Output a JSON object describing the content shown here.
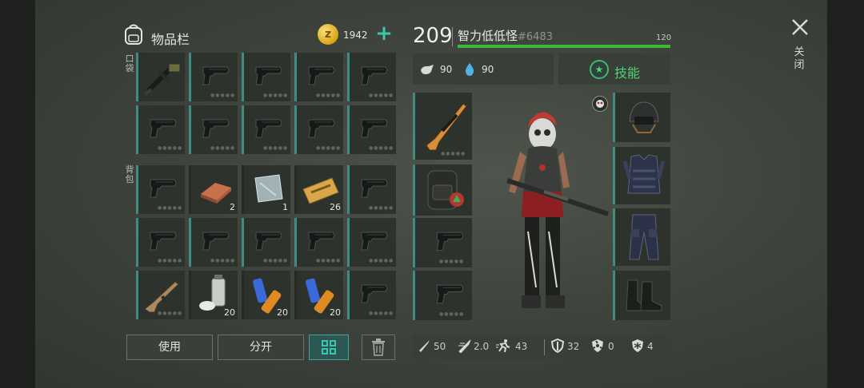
{
  "inventory": {
    "title": "物品栏",
    "pockets_label": "口袋",
    "backpack_label": "背包",
    "coins": "1942",
    "add_coin_symbol": "+"
  },
  "quantities": {
    "copper": "2",
    "steel": "1",
    "coupon": "26",
    "spray": "20",
    "battery1": "20",
    "battery2": "20"
  },
  "buttons": {
    "use": "使用",
    "split": "分开"
  },
  "character": {
    "level": "209",
    "name": "智力低低怪",
    "id": "#6483",
    "xp_max": "120",
    "food": "90",
    "water": "90",
    "skills_label": "技能"
  },
  "stats": {
    "attack": "50",
    "attack_speed": "2.0",
    "speed": "43",
    "defense": "32",
    "radiation": "0",
    "cold": "4"
  },
  "close": {
    "label": "关闭"
  },
  "colors": {
    "accent_teal": "#3bc6b0",
    "xp_green": "#3fb83a",
    "skill_green": "#4fd27a"
  }
}
